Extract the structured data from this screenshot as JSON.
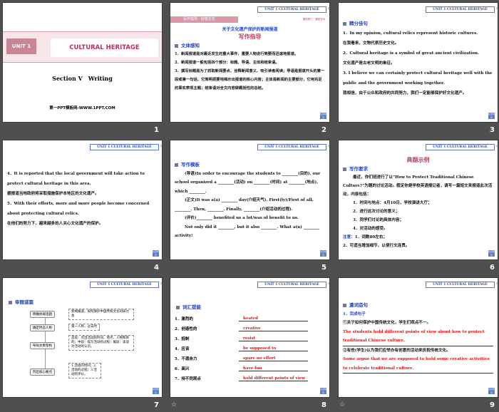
{
  "slides": [
    {
      "num": "1",
      "unit": "UNIT 1",
      "title": "CULTURAL HERITAGE",
      "section": "Section Ⅴ　Writing",
      "site": "第一PPT模板网-WWW.1PPT.COM"
    },
    {
      "num": "2",
      "header": "UNIT 1  CULTURAL HERITAGE",
      "tab": "写作指导 · 妙笔生花",
      "tab_right": "课前预习 · 课堂互动",
      "subtitle": "关于文化遗产保护的新闻报道",
      "banner": "写作指导",
      "section": "文体感知",
      "lines": [
        "1．新闻报道是对最近发生的重大事件、重要人物进行简要而迅速地报道。",
        "2．新闻报道一般包括四个部分：标题、导语、主体和结束语。",
        "3．撰写标题是为了抓取新闻要点、诠释新闻意义、吸引读者阅读；导语是报道开头的第一段或第一句话，它简明扼要地揭示出报道的核心内容；主体是新闻的主要部分，它用充足的事实表现主题；结束语对全文内容做概括性的总结。"
      ],
      "back": "栏目导引"
    },
    {
      "num": "3",
      "header": "UNIT 1  CULTURAL HERITAGE",
      "section": "精分佳句",
      "lines": [
        "1．In my opinion, cultural relics represent historic cultures.",
        "在我看来，文物代表历史文化。",
        "2．Cultural heritage is a symbol of great ancient civilization.",
        "文化遗产是古老文明的象征。",
        "3. I believe we can certainly protect cultural heritage well with the public and the government working together.",
        "我相信，由于公众和政府的共同努力，我们一定能够保护好文化遗产。"
      ],
      "back": "栏目导引"
    },
    {
      "num": "4",
      "header": "UNIT 1  CULTURAL HERITAGE",
      "lines": [
        "4．It is reported that the local government will take action to protect cultural heritage in this area.",
        "据报道当地政府将采取措施保护本地区的文化遗产。",
        "5．With their efforts, more and more people become concerned about protecting cultural relics.",
        "在他们的努力下，越来越多的人关心文化遗产的保护。"
      ],
      "back": "栏目导引"
    },
    {
      "num": "5",
      "header": "UNIT 1  CULTURAL HERITAGE",
      "section": "写作模板",
      "lines": [
        "(导语)In order to encourage the students to ________(目的), our school organized a ________(活动) on ________(时间) at ________(地点), which ________.",
        "(正文)It was a(a) ________ day(介绍天气). First(ly)/First of all, ________. Then, ________. Finally, ________(介绍活动的过程).",
        "(评价)________ benefited us a lot/was of benefit to us.",
        "Not only did it ________, but it also ________. What a(n) ________ activity!"
      ],
      "back": "栏目导引"
    },
    {
      "num": "6",
      "header": "UNIT 1  CULTURAL HERITAGE",
      "banner": "典题示例",
      "section": "写作要求",
      "intro": "最近，你们班进行了以“How to Protect Traditional Chinese Culture?”为题的讨论活动。假定你是学校英语报记者，请写一篇短文来报道此次活动，内容包括：",
      "items": [
        "1．时间与地点：4月10日，学校演讲大厅；",
        "2．进行这次讨论的意义；",
        "3．同学们讨论的具体内容；",
        "4．对活动的感受。"
      ],
      "note_label": "注意：",
      "note1": "1．词数80左右；",
      "note2": "2．可适当增加细节，以使行文连贯。",
      "back": "栏目导引"
    },
    {
      "num": "7",
      "header": "UNIT 1  CULTURAL HERITAGE",
      "section": "审题谋篇",
      "steps": [
        "明确体裁话题",
        "确定时态人称",
        "布局文章架构",
        "列出核心要点"
      ],
      "details": [
        "新闻报道，如何保护中国传统文化的研讨会",
        "第一人称，过去时",
        "首段：点出活动的时间、地点、人物和目的；中段：描写活动的过程；尾段：谈谈对活动的认识。",
        "1.活动的时间；2.活动的过程；3.活动的评价。"
      ],
      "back": "栏目导引"
    },
    {
      "num": "8",
      "header": "UNIT 1  CULTURAL HERITAGE",
      "section": "词汇提能",
      "items": [
        {
          "cn": "1．激烈的",
          "en": "heated"
        },
        {
          "cn": "2．创造性的",
          "en": "creative"
        },
        {
          "cn": "3．抵制",
          "en": "resist"
        },
        {
          "cn": "4．应该",
          "en": "be supposed to"
        },
        {
          "cn": "5．不遗余力",
          "en": "spare no effort"
        },
        {
          "cn": "6．高兴",
          "en": "have fun"
        },
        {
          "cn": "7．持不同观点",
          "en": "hold different points of view"
        }
      ],
      "back": "栏目导引"
    },
    {
      "num": "9",
      "header": "UNIT 1  CULTURAL HERITAGE",
      "section": "遣词造句",
      "sub": "1．完成句子",
      "q1": "①关于如何保护中国传统文化，学生们观点不一。",
      "a1": "The students hold different points of view about how to protect traditional Chinese culture.",
      "q2": "②有些(学生)认为我们应举办有创意的活动来庆祝传统文化。",
      "a2": "Some argue that we are supposed to hold some creative activities to celebrate traditional culture.",
      "back": "栏目导引"
    }
  ],
  "star_icon": "☆"
}
